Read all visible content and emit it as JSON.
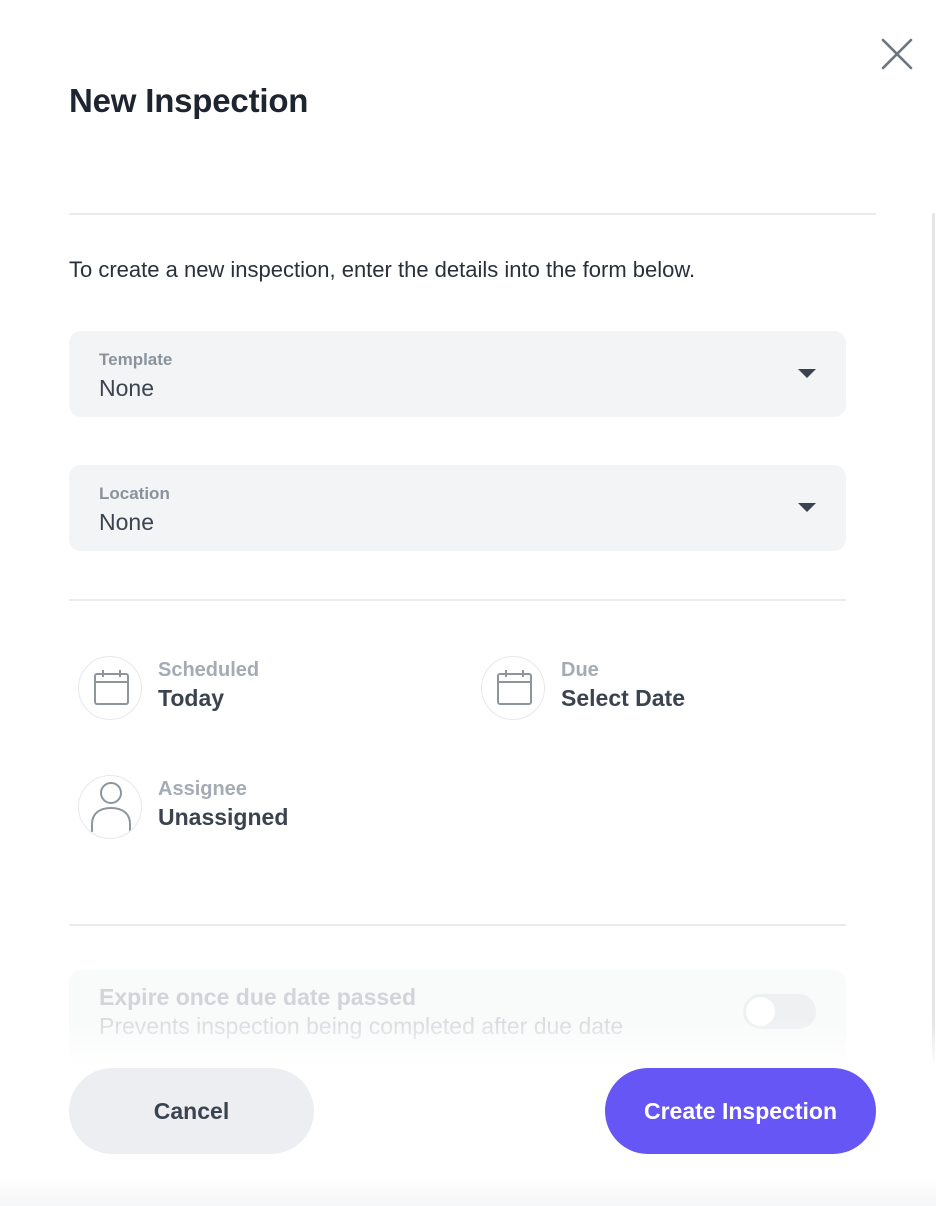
{
  "dialog": {
    "title": "New Inspection",
    "intro": "To create a new inspection, enter the details into the form below."
  },
  "form": {
    "template": {
      "label": "Template",
      "value": "None"
    },
    "location": {
      "label": "Location",
      "value": "None"
    },
    "scheduled": {
      "label": "Scheduled",
      "value": "Today",
      "icon": "calendar-icon"
    },
    "due": {
      "label": "Due",
      "value": "Select Date",
      "icon": "calendar-icon"
    },
    "assignee": {
      "label": "Assignee",
      "value": "Unassigned",
      "icon": "user-icon"
    },
    "expire": {
      "title": "Expire once due date passed",
      "subtitle": "Prevents inspection being completed after due date",
      "enabled": false
    }
  },
  "actions": {
    "cancel_label": "Cancel",
    "create_label": "Create Inspection"
  },
  "colors": {
    "accent": "#6656f5",
    "field_background": "#f3f4f6",
    "text_primary": "#1f2530"
  }
}
